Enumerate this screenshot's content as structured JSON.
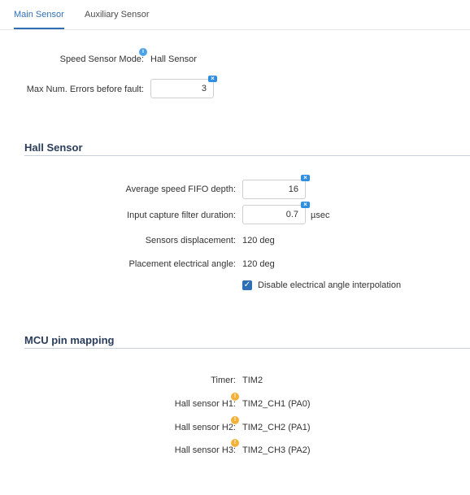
{
  "tabs": [
    {
      "label": "Main Sensor",
      "active": true
    },
    {
      "label": "Auxiliary Sensor",
      "active": false
    }
  ],
  "main": {
    "speed_sensor_mode_label": "Speed Sensor Mode:",
    "speed_sensor_mode_value": "Hall Sensor",
    "max_errors_label": "Max Num. Errors before fault:",
    "max_errors_value": "3"
  },
  "hall_sensor": {
    "title": "Hall Sensor",
    "fifo_label": "Average speed FIFO depth:",
    "fifo_value": "16",
    "filter_label": "Input capture filter duration:",
    "filter_value": "0.7",
    "filter_unit": "µsec",
    "displacement_label": "Sensors displacement:",
    "displacement_value": "120 deg",
    "placement_label": "Placement electrical angle:",
    "placement_value": "120 deg",
    "interpolation_label": "Disable electrical angle interpolation",
    "interpolation_checked": true
  },
  "mcu_pin_mapping": {
    "title": "MCU pin mapping",
    "timer_label": "Timer:",
    "timer_value": "TIM2",
    "h1_label": "Hall sensor H1:",
    "h1_value": "TIM2_CH1 (PA0)",
    "h2_label": "Hall sensor H2:",
    "h2_value": "TIM2_CH2 (PA1)",
    "h3_label": "Hall sensor H3:",
    "h3_value": "TIM2_CH3 (PA2)"
  },
  "colors": {
    "accent": "#2f6fb6",
    "info": "#4aa3ea",
    "warning": "#f2b23a",
    "section_title": "#2a3d5b"
  },
  "icons": {
    "info": "info-icon",
    "warning": "warning-icon",
    "clear": "clear-icon",
    "check": "check-icon"
  }
}
